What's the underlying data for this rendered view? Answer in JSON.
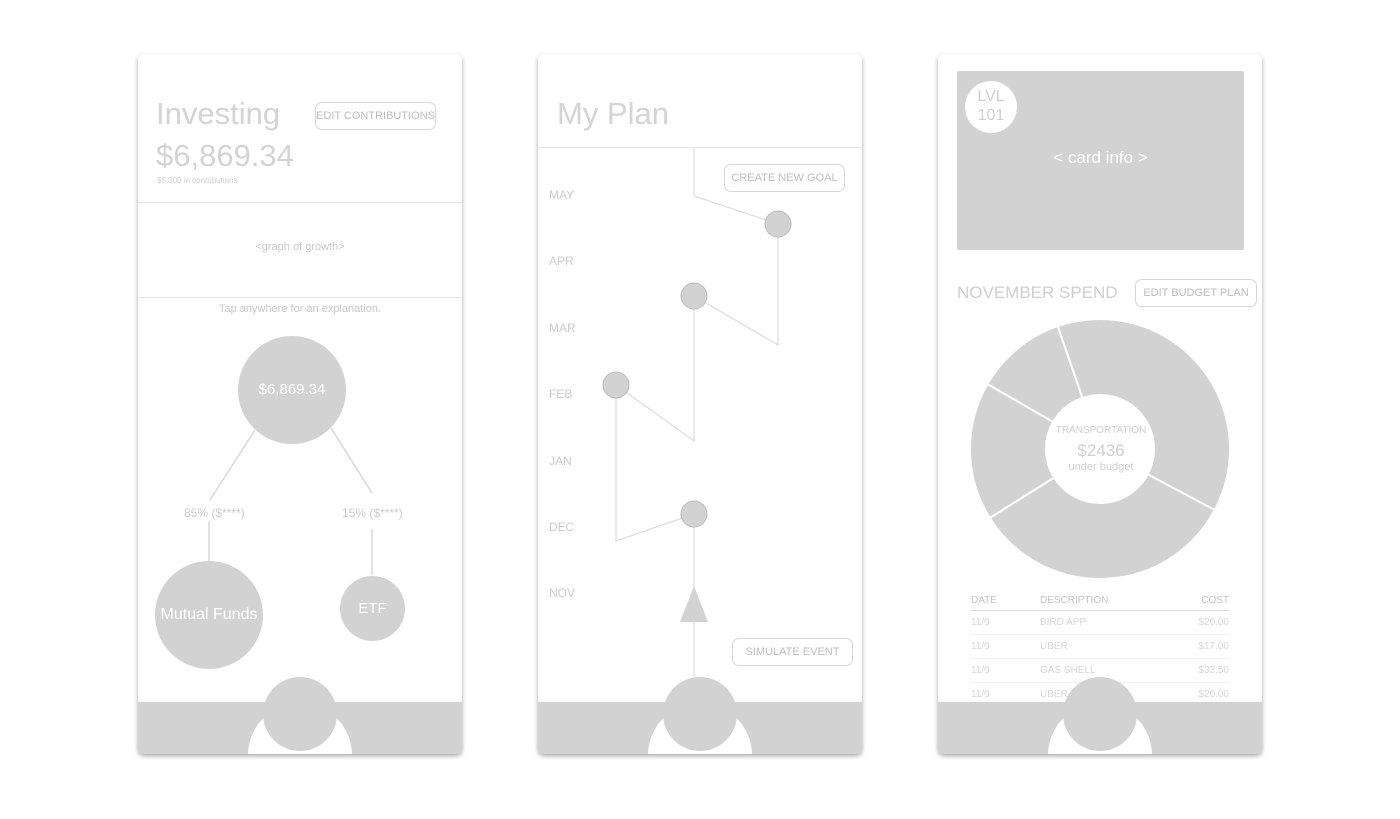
{
  "investing": {
    "title": "Investing",
    "edit_button": "EDIT CONTRIBUTIONS",
    "balance": "$6,869.34",
    "contributions_note": "$5,000 in contributions",
    "graph_placeholder": "<graph of growth>",
    "tap_hint": "Tap anywhere for an explanation.",
    "tree": {
      "root_label": "$6,869.34",
      "left_pct": "85% ($****)",
      "right_pct": "15% ($****)",
      "left_node": "Mutual Funds",
      "right_node": "ETF"
    }
  },
  "plan": {
    "title": "My Plan",
    "create_goal_button": "CREATE NEW GOAL",
    "simulate_button": "SIMULATE EVENT",
    "months": [
      "MAY",
      "APR",
      "MAR",
      "FEB",
      "JAN",
      "DEC",
      "NOV"
    ]
  },
  "spend": {
    "level_line1": "LVL",
    "level_line2": "101",
    "card_placeholder": "< card info >",
    "title": "NOVEMBER SPEND",
    "edit_button": "EDIT BUDGET PLAN",
    "donut_center": {
      "category": "TRANSPORTATION",
      "amount": "$2436",
      "status": "under budget"
    },
    "table": {
      "headers": [
        "DATE",
        "DESCRIPTION",
        "COST"
      ],
      "rows": [
        [
          "11/9",
          "BIRD APP",
          "$20.00"
        ],
        [
          "11/9",
          "UBER",
          "$17.00"
        ],
        [
          "11/9",
          "GAS SHELL",
          "$32.50"
        ],
        [
          "11/9",
          "UBER",
          "$20.00"
        ]
      ]
    }
  }
}
